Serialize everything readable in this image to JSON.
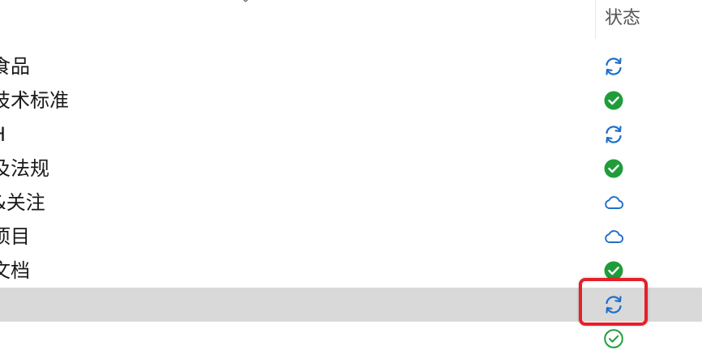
{
  "header": {
    "status_label": "状态"
  },
  "rows": [
    {
      "name": "食品",
      "status": "syncing",
      "selected": false
    },
    {
      "name": "技术标准",
      "status": "synced-filled",
      "selected": false
    },
    {
      "name": "H",
      "status": "syncing",
      "selected": false
    },
    {
      "name": "及法规",
      "status": "synced-filled",
      "selected": false
    },
    {
      "name": "&关注",
      "status": "cloud-only",
      "selected": false
    },
    {
      "name": "项目",
      "status": "cloud-only",
      "selected": false
    },
    {
      "name": "文档",
      "status": "synced-filled",
      "selected": false
    },
    {
      "name": "",
      "status": "syncing",
      "selected": true
    },
    {
      "name": "",
      "status": "synced-outline",
      "selected": false
    }
  ],
  "colors": {
    "sync_blue": "#1f6fc8",
    "synced_green": "#1f9d3a",
    "selected_row": "#d9d9d9",
    "highlight_red": "#e4202a"
  },
  "icons": {
    "syncing": "sync-arrows-icon",
    "synced-filled": "check-circle-filled-icon",
    "synced-outline": "check-circle-outline-icon",
    "cloud-only": "cloud-icon",
    "close": "close-icon"
  }
}
